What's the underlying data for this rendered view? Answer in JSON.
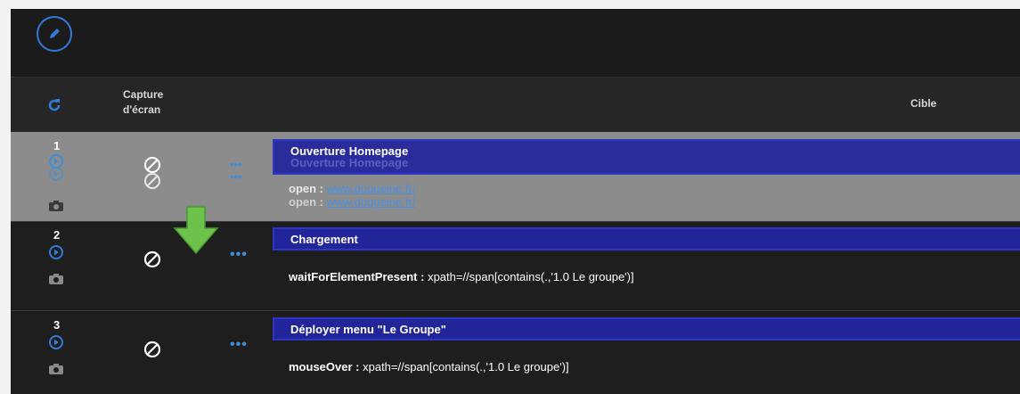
{
  "header": {
    "capture_label": "Capture d'écran",
    "cible_label": "Cible"
  },
  "rows": [
    {
      "number": "1",
      "description": "Ouverture Homepage",
      "command": "open :",
      "target": "www.duqueine.fr/"
    },
    {
      "number": "2",
      "description": "Chargement",
      "command": "waitForElementPresent :",
      "target": "xpath=//span[contains(.,'1.0 Le groupe')]"
    },
    {
      "number": "3",
      "description": "Déployer menu \"Le Groupe\"",
      "command": "mouseOver :",
      "target": "xpath=//span[contains(.,'1.0 Le groupe')]"
    }
  ],
  "colors": {
    "accent_blue": "#2f7bd8",
    "description_bar": "#22249a",
    "drop_arrow": "#6cc24a"
  },
  "icons": {
    "edit": "pencil-icon",
    "refresh": "refresh-icon",
    "play": "play-circle-icon",
    "camera": "camera-icon",
    "no_capture": "no-capture-icon",
    "more": "more-dots-icon",
    "drag_drop": "drop-arrow-icon"
  }
}
